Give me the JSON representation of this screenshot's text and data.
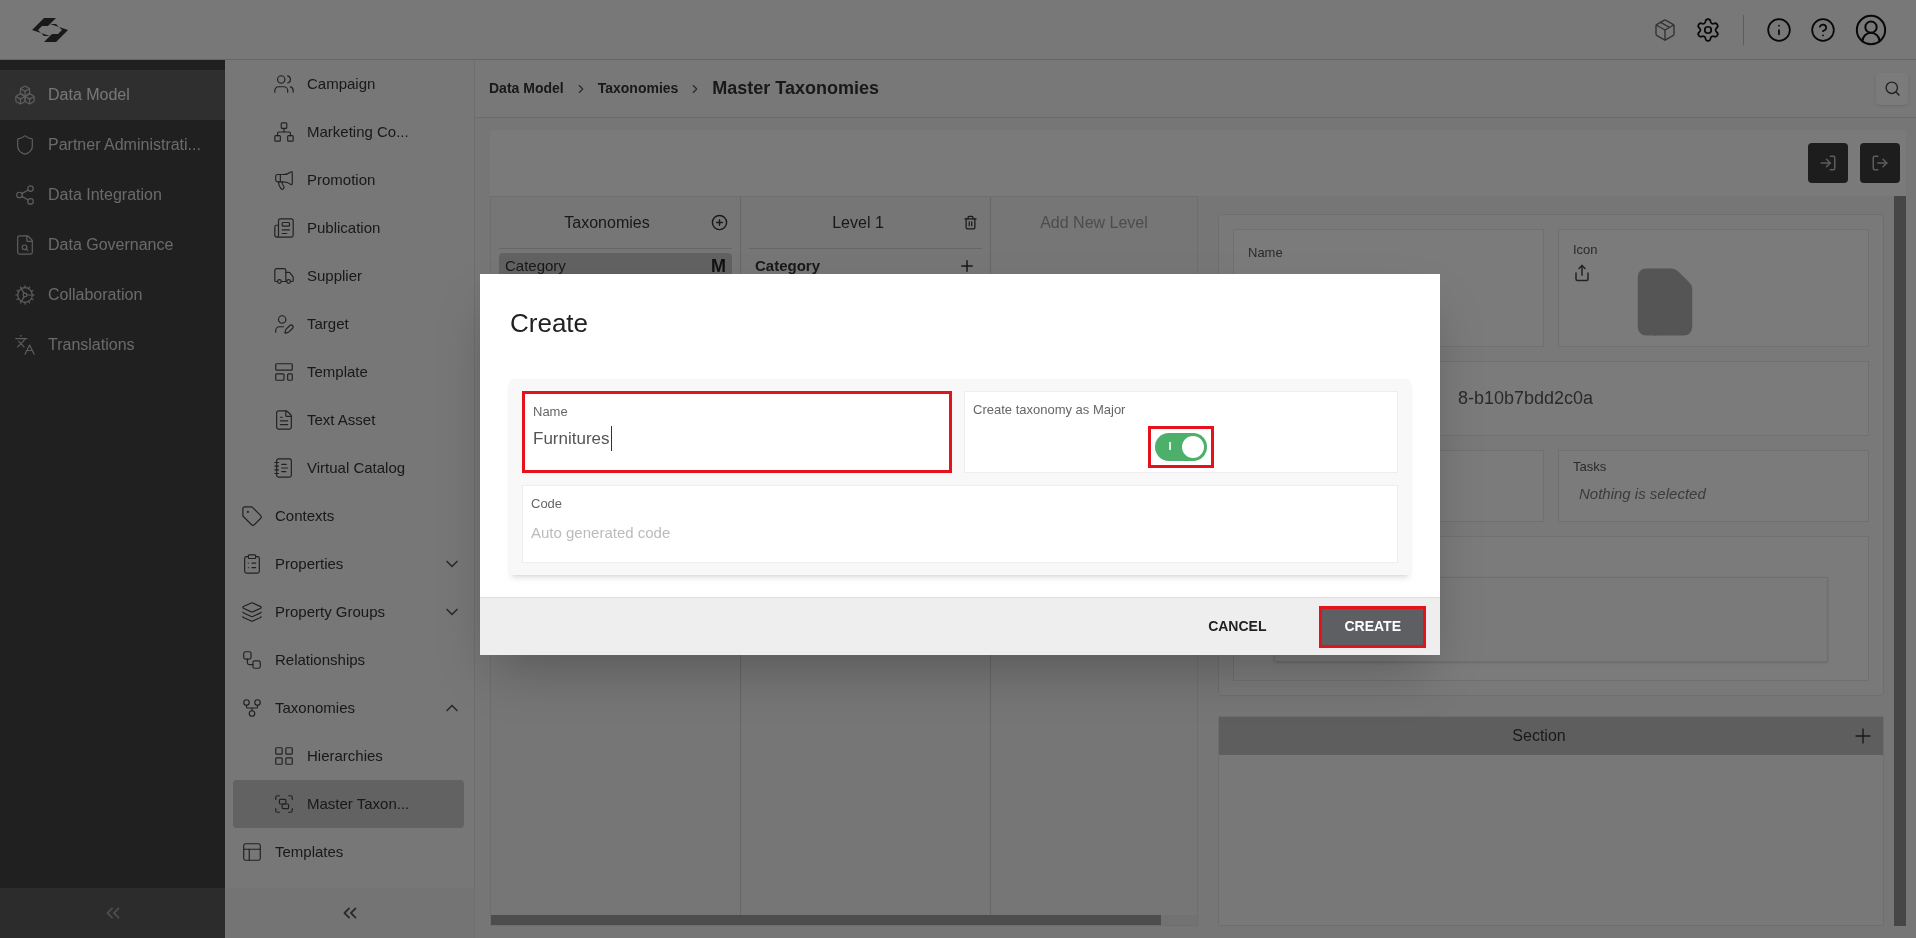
{
  "main_nav": {
    "items": [
      {
        "label": "Data Model",
        "selected": true
      },
      {
        "label": "Partner Administrati...",
        "selected": false
      },
      {
        "label": "Data Integration",
        "selected": false
      },
      {
        "label": "Data Governance",
        "selected": false
      },
      {
        "label": "Collaboration",
        "selected": false
      },
      {
        "label": "Translations",
        "selected": false
      }
    ]
  },
  "sub_nav": {
    "continued_children": [
      {
        "label": "Campaign",
        "selected": false
      },
      {
        "label": "Marketing Co...",
        "selected": false
      },
      {
        "label": "Promotion",
        "selected": false
      },
      {
        "label": "Publication",
        "selected": false
      },
      {
        "label": "Supplier",
        "selected": false
      },
      {
        "label": "Target",
        "selected": false
      },
      {
        "label": "Template",
        "selected": false
      },
      {
        "label": "Text Asset",
        "selected": false
      },
      {
        "label": "Virtual Catalog",
        "selected": false
      }
    ],
    "items": [
      {
        "label": "Contexts",
        "selected": false
      },
      {
        "label": "Properties",
        "selected": false,
        "expanded": false
      },
      {
        "label": "Property Groups",
        "selected": false,
        "expanded": false
      },
      {
        "label": "Relationships",
        "selected": false
      },
      {
        "label": "Taxonomies",
        "selected": false,
        "expanded": true,
        "children": [
          {
            "label": "Hierarchies",
            "selected": false
          },
          {
            "label": "Master Taxon...",
            "selected": true
          }
        ]
      },
      {
        "label": "Templates",
        "selected": false
      }
    ]
  },
  "breadcrumb": {
    "links": [
      "Data Model",
      "Taxonomies"
    ],
    "current": "Master Taxonomies"
  },
  "columns": {
    "taxonomies": {
      "title": "Taxonomies",
      "items": [
        {
          "label": "Category",
          "badge": "M",
          "selected": true
        }
      ]
    },
    "level": {
      "title": "Level 1",
      "items": [
        {
          "label": "Category"
        }
      ]
    },
    "add_level": "Add New Level"
  },
  "details": {
    "name_label": "Name",
    "icon_label": "Icon",
    "id_value": "8-b10b7bdd2c0a",
    "tasks_label": "Tasks",
    "tasks_value": "Nothing is selected",
    "section_title": "Section"
  },
  "dialog": {
    "title": "Create",
    "name": {
      "label": "Name",
      "value": "Furnitures",
      "highlighted": true
    },
    "major": {
      "label": "Create taxonomy as Major",
      "on": true,
      "on_text": "I",
      "highlighted": true
    },
    "code": {
      "label": "Code",
      "placeholder": "Auto generated code"
    },
    "buttons": [
      {
        "label": "CANCEL",
        "kind": "text",
        "highlighted": false
      },
      {
        "label": "CREATE",
        "kind": "primary",
        "highlighted": true
      }
    ]
  }
}
